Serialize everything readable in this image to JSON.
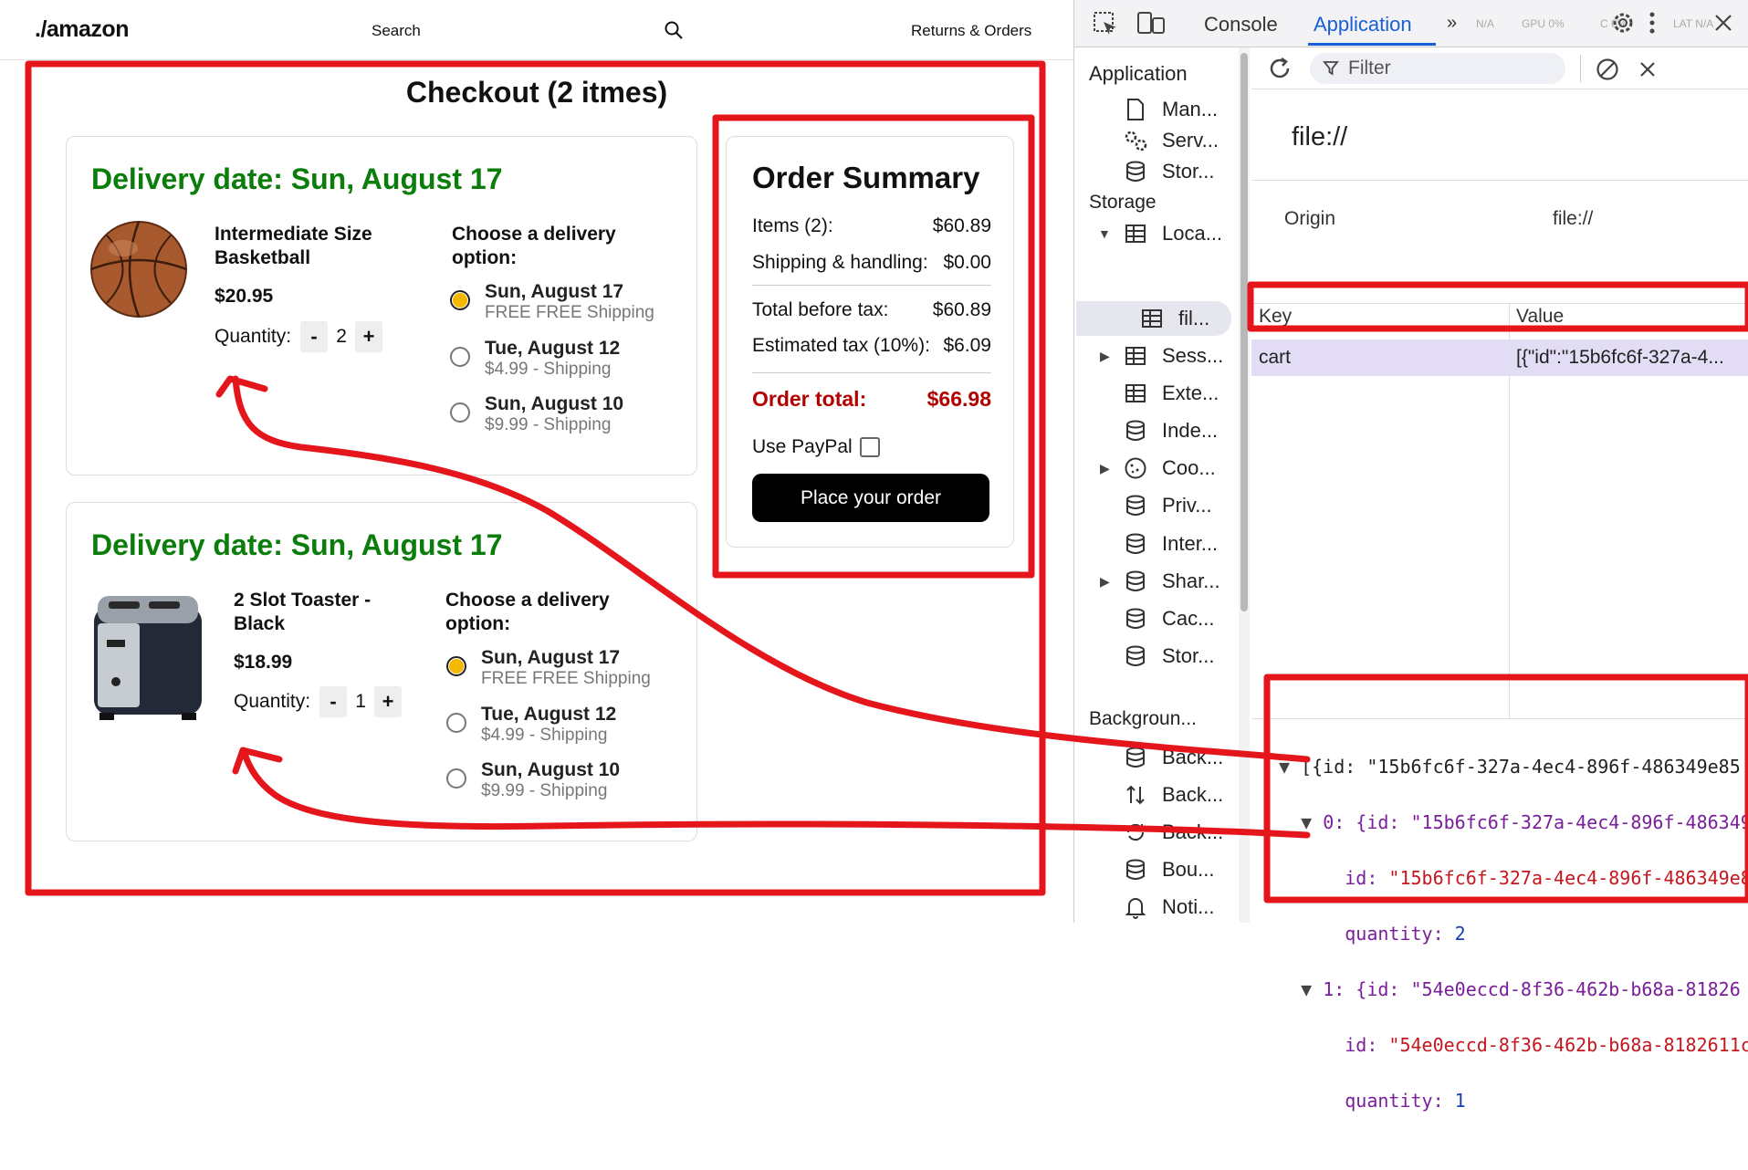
{
  "site": {
    "logo": "./amazon",
    "search_label": "Search",
    "returns_label": "Returns & Orders",
    "checkout_title": "Checkout (2 itmes)"
  },
  "cart_items": [
    {
      "delivery_date": "Delivery date: Sun, August 17",
      "name": "Intermediate Size Basketball",
      "price": "$20.95",
      "quantity_label": "Quantity:",
      "quantity": "2",
      "choose_label": "Choose a delivery option:",
      "options": [
        {
          "date": "Sun, August 17",
          "shipping": "FREE FREE Shipping",
          "selected": true
        },
        {
          "date": "Tue, August 12",
          "shipping": "$4.99 - Shipping",
          "selected": false
        },
        {
          "date": "Sun, August 10",
          "shipping": "$9.99 - Shipping",
          "selected": false
        }
      ]
    },
    {
      "delivery_date": "Delivery date: Sun, August 17",
      "name": "2 Slot Toaster - Black",
      "price": "$18.99",
      "quantity_label": "Quantity:",
      "quantity": "1",
      "choose_label": "Choose a delivery option:",
      "options": [
        {
          "date": "Sun, August 17",
          "shipping": "FREE FREE Shipping",
          "selected": true
        },
        {
          "date": "Tue, August 12",
          "shipping": "$4.99 - Shipping",
          "selected": false
        },
        {
          "date": "Sun, August 10",
          "shipping": "$9.99 - Shipping",
          "selected": false
        }
      ]
    }
  ],
  "summary": {
    "title": "Order Summary",
    "items_label": "Items (2):",
    "items_value": "$60.89",
    "shipping_label": "Shipping & handling:",
    "shipping_value": "$0.00",
    "before_tax_label": "Total before tax:",
    "before_tax_value": "$60.89",
    "tax_label": "Estimated tax (10%):",
    "tax_value": "$6.09",
    "total_label": "Order total:",
    "total_value": "$66.98",
    "paypal_label": "Use PayPal",
    "place_order": "Place your order"
  },
  "devtools": {
    "tabs": {
      "console": "Console",
      "application": "Application"
    },
    "perf": {
      "na": "N/A",
      "gpu": "GPU 0%",
      "cpu": "C 6%",
      "lat": "LAT N/A"
    },
    "sidebar": {
      "application_head": "Application",
      "app_items": [
        "Man...",
        "Serv...",
        "Stor..."
      ],
      "storage_head": "Storage",
      "storage_items": [
        "Loca...",
        "fil...",
        "Sess...",
        "Exte...",
        "Inde...",
        "Coo...",
        "Priv...",
        "Inter...",
        "Shar...",
        "Cac...",
        "Stor..."
      ],
      "background_head": "Backgroun...",
      "background_items": [
        "Back...",
        "Back...",
        "Back...",
        "Bou...",
        "Noti..."
      ]
    },
    "filter_placeholder": "Filter",
    "origin_title": "file://",
    "origin_label": "Origin",
    "origin_value": "file://",
    "key_header": "Key",
    "value_header": "Value",
    "row_key": "cart",
    "row_value": "[{\"id\":\"15b6fc6f-327a-4...",
    "json": {
      "root": "[{id: \"15b6fc6f-327a-4ec4-896f-486349e85",
      "item0": "0: {id: \"15b6fc6f-327a-4ec4-896f-486349",
      "item0_id_key": "id:",
      "item0_id": "\"15b6fc6f-327a-4ec4-896f-486349e8",
      "item0_qty_key": "quantity:",
      "item0_qty": "2",
      "item1": "1: {id: \"54e0eccd-8f36-462b-b68a-81826",
      "item1_id_key": "id:",
      "item1_id": "\"54e0eccd-8f36-462b-b68a-8182611c",
      "item1_qty_key": "quantity:",
      "item1_qty": "1"
    }
  },
  "colors": {
    "annotation_red": "#e4161c",
    "delivery_green": "#0a7d0a",
    "total_red": "#b30000",
    "selected_radio": "#f5b800",
    "devtools_accent": "#1a5fd6"
  }
}
